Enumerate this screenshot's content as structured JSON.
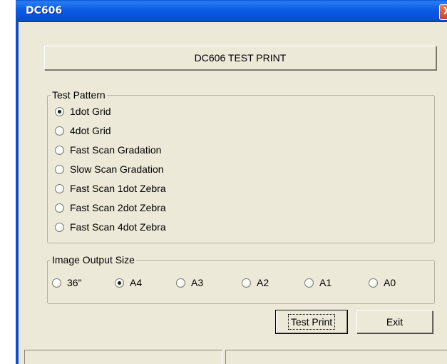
{
  "window": {
    "title": "DC606",
    "close_glyph": "X"
  },
  "header": {
    "label": "DC606 TEST PRINT"
  },
  "test_pattern": {
    "legend": "Test Pattern",
    "options": [
      {
        "label": "1dot Grid",
        "checked": true
      },
      {
        "label": "4dot Grid",
        "checked": false
      },
      {
        "label": "Fast Scan Gradation",
        "checked": false
      },
      {
        "label": "Slow Scan Gradation",
        "checked": false
      },
      {
        "label": "Fast Scan 1dot Zebra",
        "checked": false
      },
      {
        "label": "Fast Scan 2dot Zebra",
        "checked": false
      },
      {
        "label": "Fast Scan 4dot Zebra",
        "checked": false
      }
    ]
  },
  "image_output_size": {
    "legend": "Image Output Size",
    "options": [
      {
        "label": "36\"",
        "checked": false
      },
      {
        "label": "A4",
        "checked": true
      },
      {
        "label": "A3",
        "checked": false
      },
      {
        "label": "A2",
        "checked": false
      },
      {
        "label": "A1",
        "checked": false
      },
      {
        "label": "A0",
        "checked": false
      }
    ]
  },
  "buttons": {
    "test_print": "Test Print",
    "exit": "Exit"
  }
}
